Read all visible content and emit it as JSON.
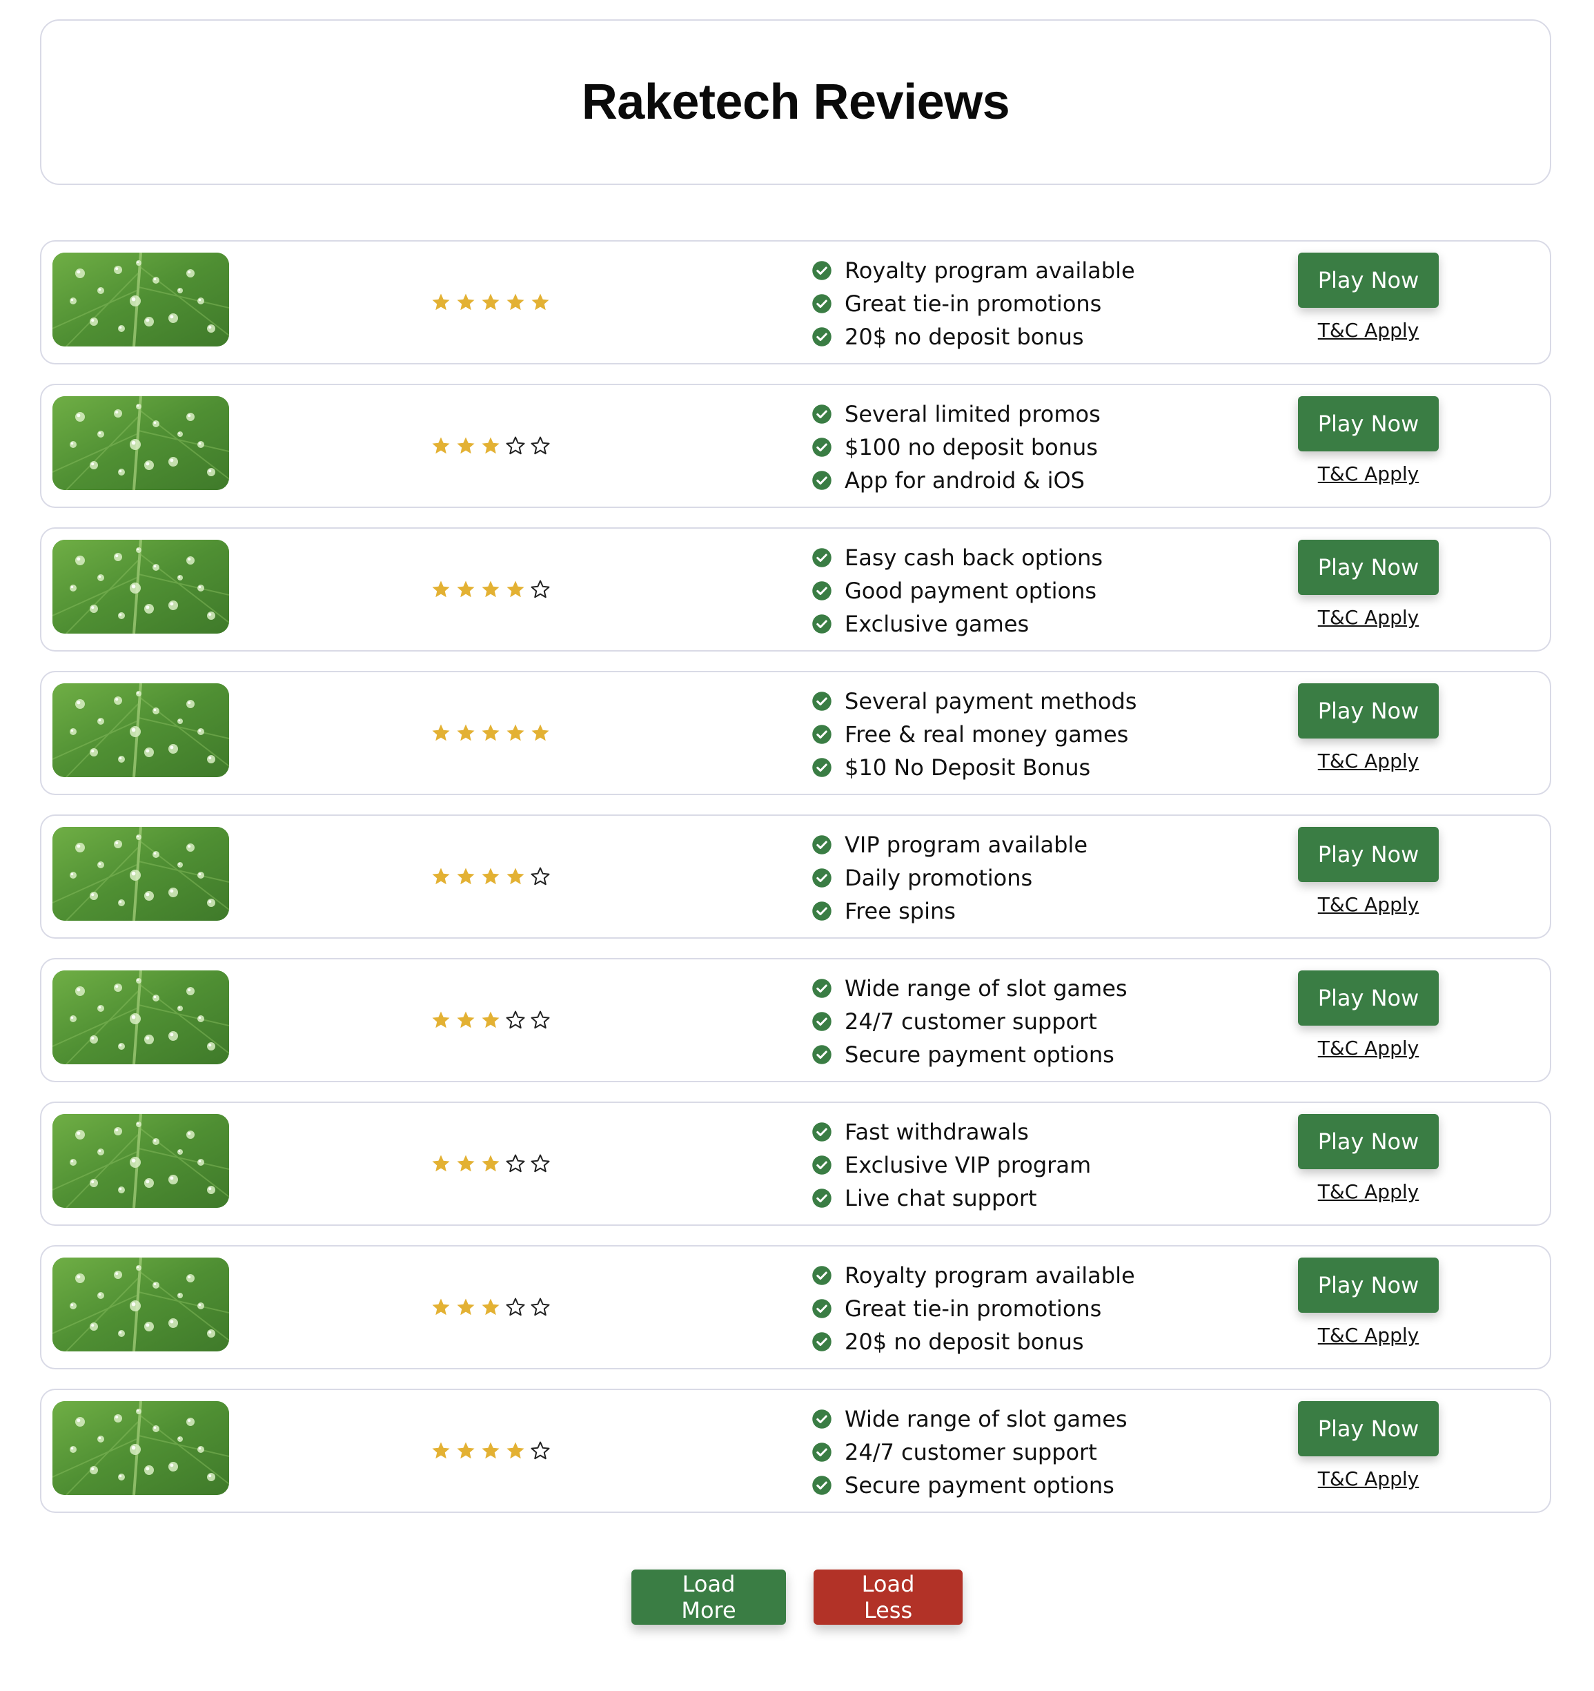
{
  "header": {
    "title": "Raketech Reviews"
  },
  "colors": {
    "star_filled": "#e3b133",
    "star_empty_stroke": "#222222",
    "check": "#3a7d44",
    "play_button": "#3a7d44",
    "load_more": "#3a7d44",
    "load_less": "#b23227",
    "border": "#d9dae6"
  },
  "reviews": [
    {
      "image_icon": "leaf-water-drops-image",
      "rating": 5,
      "max_rating": 5,
      "features": [
        "Royalty program available",
        "Great tie-in promotions",
        "20$ no deposit bonus"
      ],
      "cta_label": "Play Now",
      "terms_label": "T&C Apply"
    },
    {
      "image_icon": "leaf-water-drops-image",
      "rating": 3,
      "max_rating": 5,
      "features": [
        "Several limited promos",
        "$100 no deposit bonus",
        "App for android & iOS"
      ],
      "cta_label": "Play Now",
      "terms_label": "T&C Apply"
    },
    {
      "image_icon": "leaf-water-drops-image",
      "rating": 4,
      "max_rating": 5,
      "features": [
        "Easy cash back options",
        "Good payment options",
        "Exclusive games"
      ],
      "cta_label": "Play Now",
      "terms_label": "T&C Apply"
    },
    {
      "image_icon": "leaf-water-drops-image",
      "rating": 5,
      "max_rating": 5,
      "features": [
        "Several payment methods",
        "Free & real money games",
        "$10 No Deposit Bonus"
      ],
      "cta_label": "Play Now",
      "terms_label": "T&C Apply"
    },
    {
      "image_icon": "leaf-water-drops-image",
      "rating": 4,
      "max_rating": 5,
      "features": [
        "VIP program available",
        "Daily promotions",
        "Free spins"
      ],
      "cta_label": "Play Now",
      "terms_label": "T&C Apply"
    },
    {
      "image_icon": "leaf-water-drops-image",
      "rating": 3,
      "max_rating": 5,
      "features": [
        "Wide range of slot games",
        "24/7 customer support",
        "Secure payment options"
      ],
      "cta_label": "Play Now",
      "terms_label": "T&C Apply"
    },
    {
      "image_icon": "leaf-water-drops-image",
      "rating": 3,
      "max_rating": 5,
      "features": [
        "Fast withdrawals",
        "Exclusive VIP program",
        "Live chat support"
      ],
      "cta_label": "Play Now",
      "terms_label": "T&C Apply"
    },
    {
      "image_icon": "leaf-water-drops-image",
      "rating": 3,
      "max_rating": 5,
      "features": [
        "Royalty program available",
        "Great tie-in promotions",
        "20$ no deposit bonus"
      ],
      "cta_label": "Play Now",
      "terms_label": "T&C Apply"
    },
    {
      "image_icon": "leaf-water-drops-image",
      "rating": 4,
      "max_rating": 5,
      "features": [
        "Wide range of slot games",
        "24/7 customer support",
        "Secure payment options"
      ],
      "cta_label": "Play Now",
      "terms_label": "T&C Apply"
    }
  ],
  "pagination": {
    "load_more_label": "Load More",
    "load_less_label": "Load Less"
  }
}
